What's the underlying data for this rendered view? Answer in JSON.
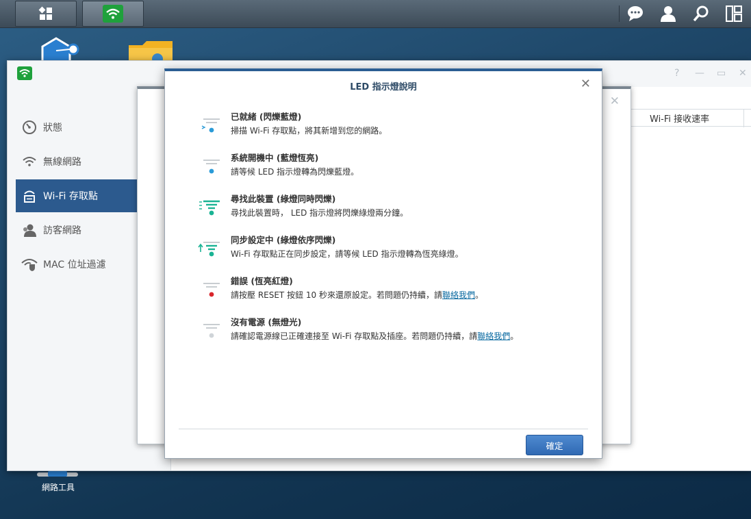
{
  "taskbar": {
    "main_menu_icon": "grid-icon",
    "active_app_icon": "wifi-icon",
    "right_icons": [
      "chat-icon",
      "user-icon",
      "search-icon",
      "widgets-icon"
    ]
  },
  "desktop": {
    "network_tools_label": "網路工具"
  },
  "window": {
    "controls": [
      "?",
      "—",
      "▭",
      "✕"
    ],
    "sidebar": {
      "items": [
        {
          "label": "狀態",
          "icon": "gauge-icon"
        },
        {
          "label": "無線網路",
          "icon": "wifi-icon"
        },
        {
          "label": "Wi-Fi 存取點",
          "icon": "access-point-icon"
        },
        {
          "label": "訪客網路",
          "icon": "guest-icon"
        },
        {
          "label": "MAC 位址過濾",
          "icon": "shield-wifi-icon"
        }
      ],
      "active_index": 2
    },
    "grid_header": "Wi-Fi 接收速率"
  },
  "modal": {
    "title": "LED 指示燈說明",
    "items": [
      {
        "title": "已就緒 (閃爍藍燈)",
        "desc": "掃描 Wi-Fi 存取點，將其新增到您的網路。",
        "color": "#2b9bd8"
      },
      {
        "title": "系統開機中 (藍燈恆亮)",
        "desc": "請等候 LED 指示燈轉為閃爍藍燈。",
        "color": "#2b9bd8"
      },
      {
        "title": "尋找此裝置 (綠燈同時閃爍)",
        "desc": "尋找此裝置時， LED 指示燈將閃爍綠燈兩分鐘。",
        "color": "#1ab394"
      },
      {
        "title": "同步設定中 (綠燈依序閃爍)",
        "desc": "Wi-Fi 存取點正在同步設定，請等候 LED 指示燈轉為恆亮綠燈。",
        "color": "#1ab394"
      },
      {
        "title": "錯誤 (恆亮紅燈)",
        "desc": "請按壓 RESET 按鈕 10 秒來還原設定。若問題仍持續，請",
        "link": "聯絡我們",
        "suffix": "。",
        "color": "#d9262c"
      },
      {
        "title": "沒有電源 (無燈光)",
        "desc": "請確認電源線已正確連接至 Wi-Fi 存取點及插座。若問題仍持續，請",
        "link": "聯絡我們",
        "suffix": "。",
        "color": "#cfd4d8"
      }
    ],
    "ok_label": "確定"
  }
}
